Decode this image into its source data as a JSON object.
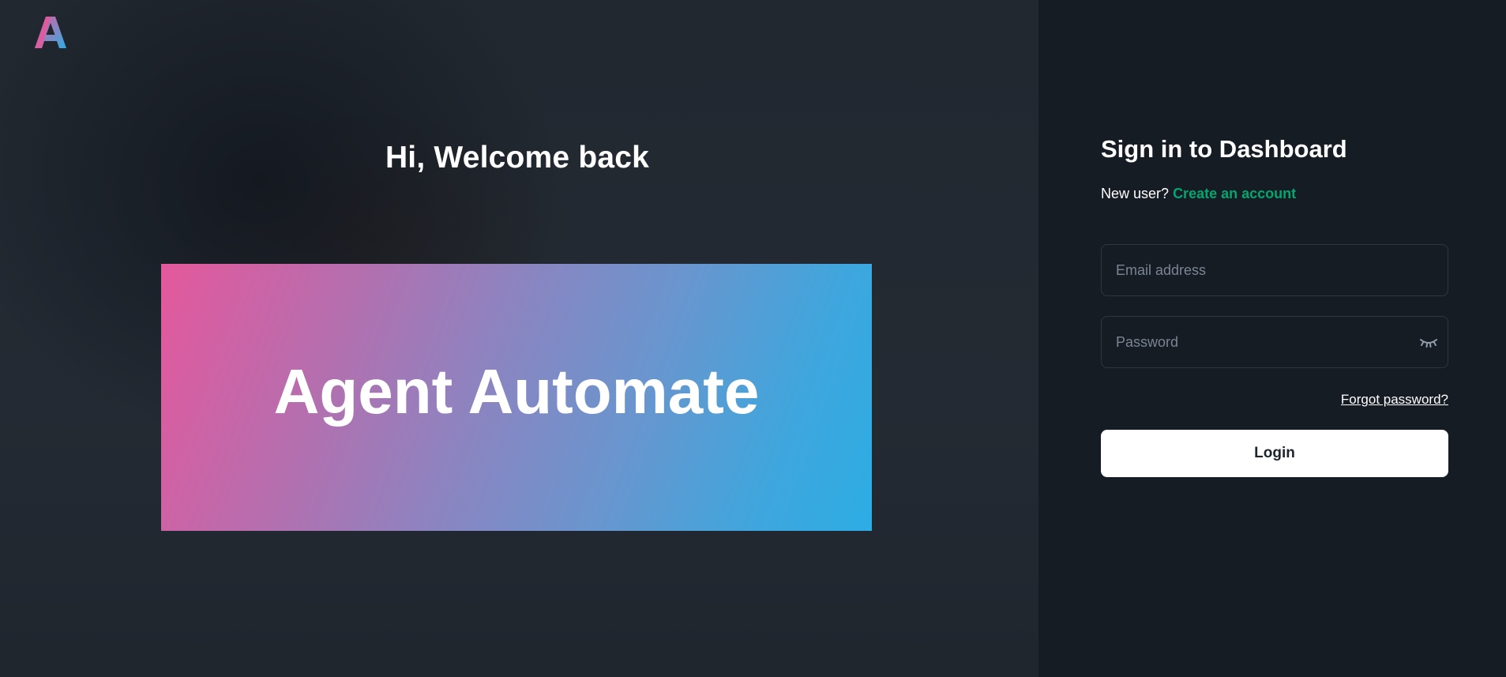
{
  "hero": {
    "title": "Hi, Welcome back",
    "banner_text": "Agent Automate",
    "logo_icon": "letter-a-gradient-logo"
  },
  "signin": {
    "title": "Sign in to Dashboard",
    "new_user_prompt": "New user?",
    "create_account_label": "Create an account",
    "email_placeholder": "Email address",
    "password_placeholder": "Password",
    "password_toggle_icon": "eye-closed-icon",
    "forgot_password_label": "Forgot password?",
    "login_label": "Login"
  },
  "colors": {
    "accent_green": "#00a76f",
    "panel_bg": "#161c24",
    "banner_gradient_start": "#e4589c",
    "banner_gradient_end": "#2cade4"
  }
}
